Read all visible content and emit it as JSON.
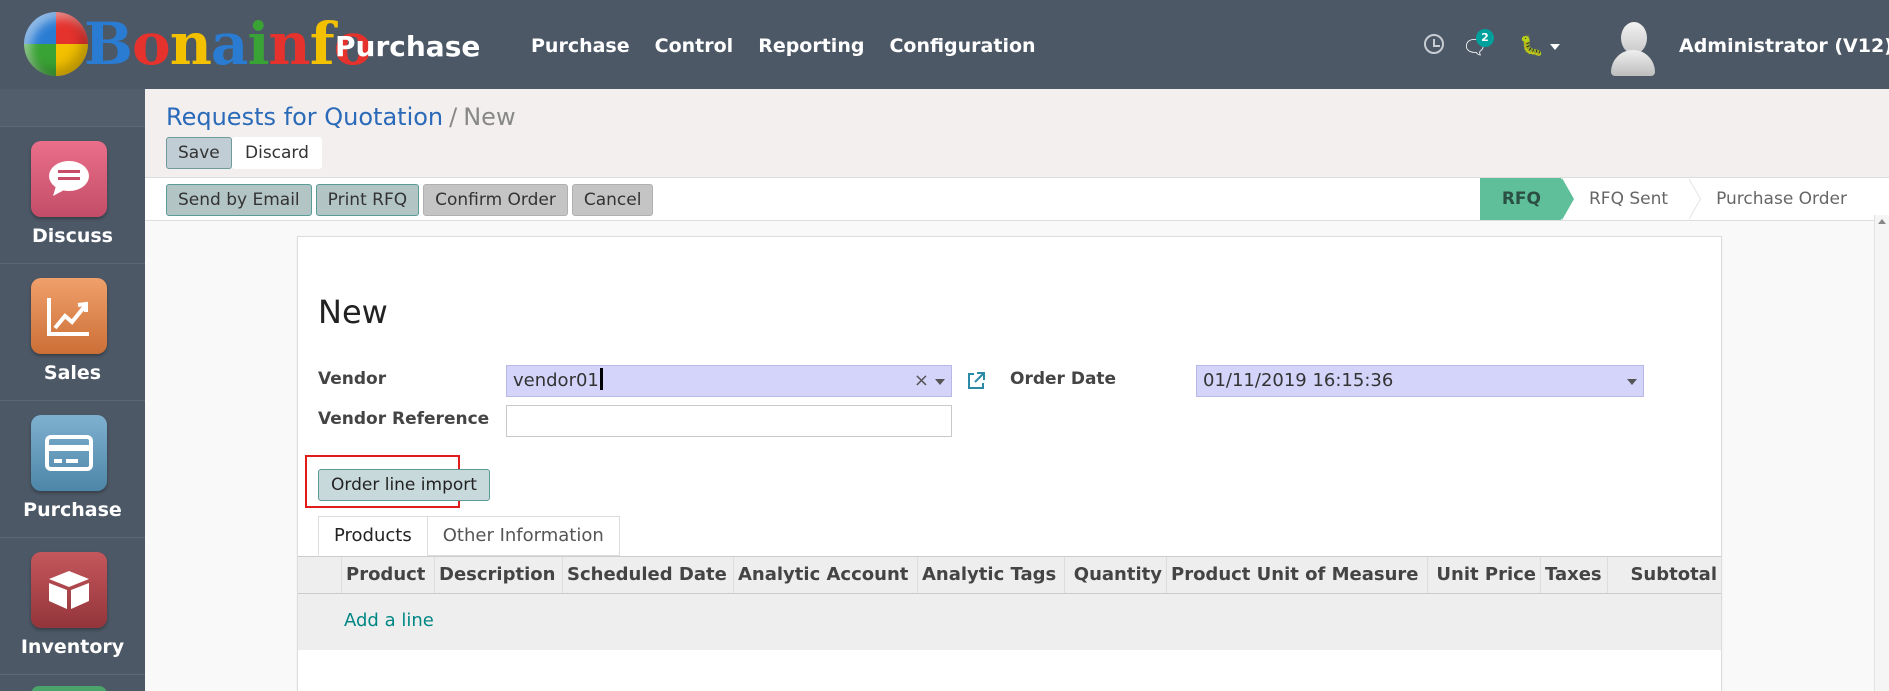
{
  "brand": {
    "logo_letters": [
      "B",
      "o",
      "n",
      "a",
      "i",
      "n",
      "f",
      "o"
    ],
    "app_name": "Purchase"
  },
  "topmenu": [
    "Purchase",
    "Control",
    "Reporting",
    "Configuration"
  ],
  "systray": {
    "messages_count": "2",
    "user": "Administrator (V12)"
  },
  "apps": [
    {
      "label": "Discuss",
      "icon": "discuss-icon"
    },
    {
      "label": "Sales",
      "icon": "sales-chart-icon"
    },
    {
      "label": "Purchase",
      "icon": "purchase-card-icon"
    },
    {
      "label": "Inventory",
      "icon": "inventory-box-icon"
    }
  ],
  "breadcrumb": {
    "parent": "Requests for Quotation",
    "separator": "/",
    "current": "New"
  },
  "actions": {
    "save": "Save",
    "discard": "Discard"
  },
  "status_buttons": [
    "Send by Email",
    "Print RFQ",
    "Confirm Order",
    "Cancel"
  ],
  "stages": {
    "items": [
      "RFQ",
      "RFQ Sent",
      "Purchase Order"
    ],
    "active": "RFQ"
  },
  "form": {
    "title": "New",
    "vendor_label": "Vendor",
    "vendor_value": "vendor01",
    "clear_symbol": "×",
    "vendor_ref_label": "Vendor Reference",
    "vendor_ref_value": "",
    "order_date_label": "Order Date",
    "order_date_value": "01/11/2019 16:15:36",
    "import_button": "Order line import"
  },
  "tabs": [
    "Products",
    "Other Information"
  ],
  "table": {
    "columns": [
      "Product",
      "Description",
      "Scheduled Date",
      "Analytic Account",
      "Analytic Tags",
      "Quantity",
      "Product Unit of Measure",
      "Unit Price",
      "Taxes",
      "Subtotal"
    ],
    "add_line": "Add a line"
  },
  "colors": {
    "topbar": "#4c5866",
    "active_stage": "#5ebf9a",
    "link": "#2a6ab8",
    "highlight": "#e21b1b"
  }
}
